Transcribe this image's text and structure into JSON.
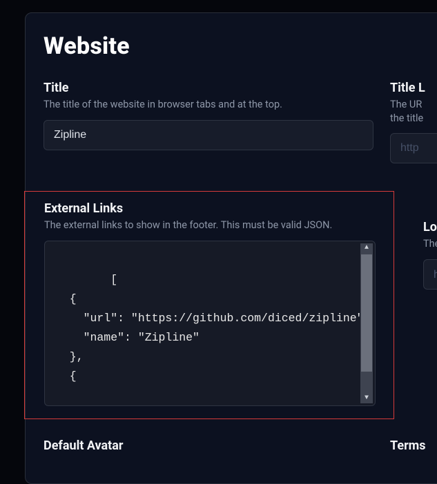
{
  "heading": "Website",
  "title_field": {
    "label": "Title",
    "desc": "The title of the website in browser tabs and at the top.",
    "value": "Zipline"
  },
  "title_right": {
    "label": "Title L",
    "desc": "The UR\nthe title",
    "placeholder": "http"
  },
  "external_links": {
    "label": "External Links",
    "desc": "The external links to show in the footer. This must be valid JSON.",
    "json": "[\n  {\n    \"url\": \"https://github.com/diced/zipline\",\n    \"name\": \"Zipline\"\n  },\n  {"
  },
  "login_field": {
    "label": "Login",
    "desc": "The UR",
    "placeholder": "http"
  },
  "default_avatar": {
    "label": "Default Avatar"
  },
  "terms": {
    "label": "Terms"
  }
}
